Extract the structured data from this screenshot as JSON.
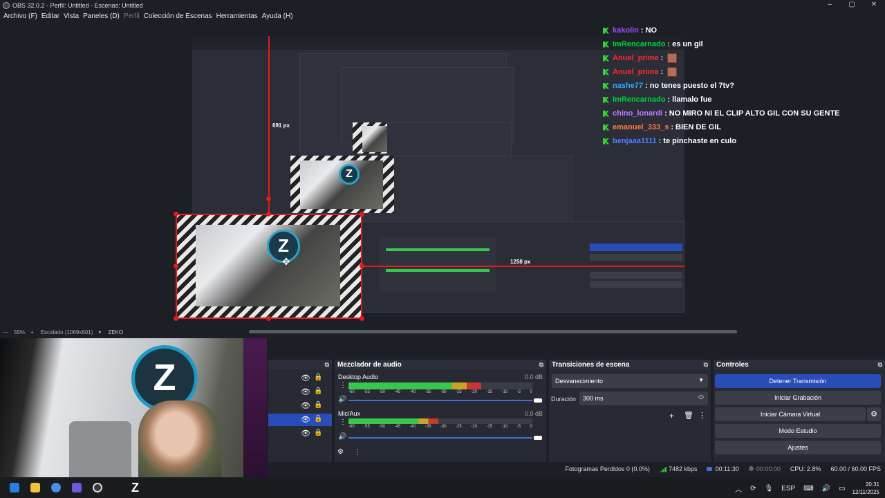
{
  "window": {
    "title": "OBS 32.0.2 - Perfil: Untitled - Escenas: Untitled",
    "controls": [
      "–",
      "▢",
      "✕"
    ]
  },
  "menu": [
    {
      "label": "Archivo (F)",
      "disabled": false
    },
    {
      "label": "Editar",
      "disabled": false
    },
    {
      "label": "Vista",
      "disabled": false
    },
    {
      "label": "Paneles (D)",
      "disabled": false
    },
    {
      "label": "Perfil",
      "disabled": true
    },
    {
      "label": "Colección de Escenas",
      "disabled": false
    },
    {
      "label": "Herramientas",
      "disabled": false
    },
    {
      "label": "Ayuda (H)",
      "disabled": false
    }
  ],
  "chat": [
    {
      "user": "kakolin",
      "message": "NO",
      "color": "#a04bff",
      "emote": false
    },
    {
      "user": "ImRencarnado",
      "message": "es un gil",
      "color": "#00d23b",
      "emote": false
    },
    {
      "user": "Anuel_prime",
      "message": "",
      "color": "#ff2a2a",
      "emote": true
    },
    {
      "user": "Anuel_prime",
      "message": "",
      "color": "#ff2a2a",
      "emote": true
    },
    {
      "user": "nashe77",
      "message": "no tenes puesto el 7tv?",
      "color": "#2aa8ff",
      "emote": false
    },
    {
      "user": "ImRencarnado",
      "message": "llamalo fue",
      "color": "#00d23b",
      "emote": false
    },
    {
      "user": "chino_lonardi",
      "message": "NO MIRO NI EL CLIP ALTO GIL CON SU GENTE",
      "color": "#c07bff",
      "emote": false
    },
    {
      "user": "emanuel_333_s",
      "message": "BIEN DE GIL",
      "color": "#ff7b39",
      "emote": false
    },
    {
      "user": "benjaaa1111",
      "message": "te pinchaste en culo",
      "color": "#4a7fff",
      "emote": false
    }
  ],
  "preview": {
    "measure_height": "691 px",
    "measure_width": "1258 px",
    "logo_text": "ZEKO"
  },
  "preview_bar": {
    "zoom": "55%",
    "zoom_in": "+",
    "scale_mode": "Escalado (1069x601)"
  },
  "sources": {
    "rows": [
      {
        "selected": false
      },
      {
        "selected": false
      },
      {
        "selected": false
      },
      {
        "selected": true
      },
      {
        "selected": false
      }
    ]
  },
  "audio": {
    "title": "Mezclador de audio",
    "channels": [
      {
        "name": "Desktop Audio",
        "db": "0.0 dB",
        "level": 0.72
      },
      {
        "name": "Mic/Aux",
        "db": "0.0 dB",
        "level": 0.49
      }
    ],
    "ticks": [
      "-60",
      "-55",
      "-50",
      "-45",
      "-40",
      "-35",
      "-30",
      "-25",
      "-20",
      "-15",
      "-10",
      "-5",
      "0"
    ]
  },
  "transitions": {
    "title": "Transiciones de escena",
    "selected": "Desvanecimiento",
    "duration_label": "Duración",
    "duration_value": "300 ms"
  },
  "controls": {
    "title": "Controles",
    "stop_stream": "Detener Transmisión",
    "start_recording": "Iniciar Grabación",
    "start_virtual_cam": "Iniciar Cámara Virtual",
    "studio_mode": "Modo Estudio",
    "settings": "Ajustes"
  },
  "status": {
    "dropped_frames": "Fotogramas Perdidos 0 (0.0%)",
    "bitrate": "7482 kbps",
    "stream_time": "00:11:30",
    "record_time": "00:00:00",
    "cpu": "CPU: 2.8%",
    "fps": "60.00 / 60.00 FPS"
  },
  "taskbar": {
    "language": "ESP",
    "time": "20:31",
    "date": "12/11/2025"
  },
  "colors": {
    "accent": "#284cb8",
    "selection": "#e21b1b",
    "dock_bg": "#272a33",
    "app_bg": "#1d1f26"
  }
}
